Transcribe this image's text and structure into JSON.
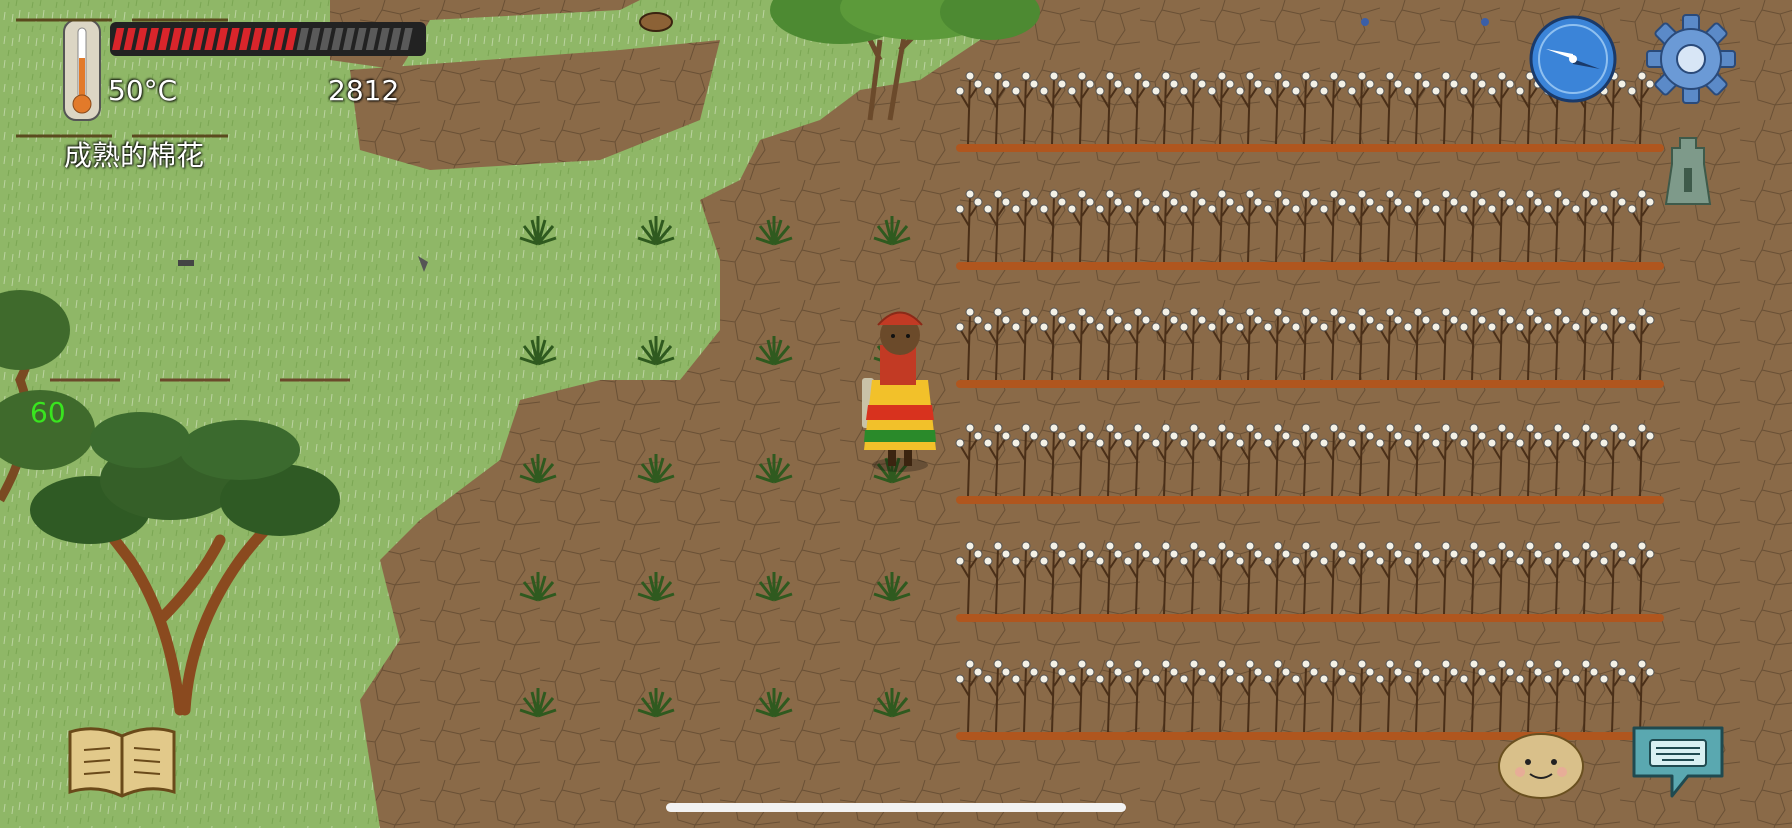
{
  "hud": {
    "temperature": "50°C",
    "score": "2812",
    "hover_object": "成熟的棉花",
    "fps": "60",
    "health_bar_segments": 26,
    "health_bar_filled": 16
  },
  "icons": {
    "thermometer": "thermometer-icon",
    "compass": "compass-icon",
    "settings": "gear-icon",
    "backpack": "bell-totem-icon",
    "recipe_book": "book-icon",
    "emote": "smiley-face-icon",
    "chat": "keyboard-chat-icon"
  },
  "colors": {
    "grass": "#8fb767",
    "soil": "#8a6a48",
    "health_fill": "#d9252b",
    "health_empty": "#5a5a5a",
    "compass_face": "#3b84d8",
    "fps_green": "#39e51f"
  },
  "world": {
    "cotton_rows": 6,
    "sprout_grid": "4x5",
    "player": "elder-woman-in-yellow-red-dress"
  }
}
